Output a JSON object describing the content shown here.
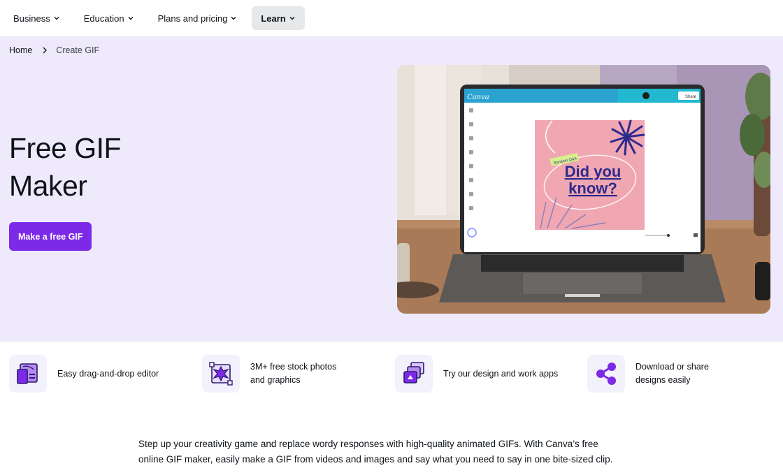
{
  "nav": {
    "items": [
      {
        "label": "Business",
        "active": false
      },
      {
        "label": "Education",
        "active": false
      },
      {
        "label": "Plans and pricing",
        "active": false
      },
      {
        "label": "Learn",
        "active": true
      }
    ]
  },
  "breadcrumb": {
    "home": "Home",
    "current": "Create GIF"
  },
  "hero": {
    "title_line1": "Free GIF",
    "title_line2": "Maker",
    "cta_label": "Make a free GIF"
  },
  "laptop_screen": {
    "brand": "Canva",
    "share_label": "Share",
    "tag": "Random Q&A",
    "headline_line1": "Did you",
    "headline_line2": "know?"
  },
  "features": [
    {
      "line1": "Easy drag-and-drop editor",
      "line2": "",
      "icon": "drag-drop-editor-icon"
    },
    {
      "line1": "3M+ free stock photos",
      "line2": "and graphics",
      "icon": "stock-graphics-icon"
    },
    {
      "line1": "Try our design and work apps",
      "line2": "",
      "icon": "apps-icon"
    },
    {
      "line1": "Download or share",
      "line2": "designs easily",
      "icon": "share-icon"
    }
  ],
  "description": {
    "line1": "Step up your creativity game and replace wordy responses with high-quality animated GIFs. With Canva’s free",
    "line2": "online GIF maker, easily make a GIF from videos and images and say what you need to say in one bite-sized clip."
  },
  "colors": {
    "accent": "#7d2ae8",
    "hero_bg": "#eeeafc",
    "nav_active_bg": "#e6e8ea",
    "card_pink": "#f0a7b2",
    "card_navy": "#2d2a8e"
  }
}
